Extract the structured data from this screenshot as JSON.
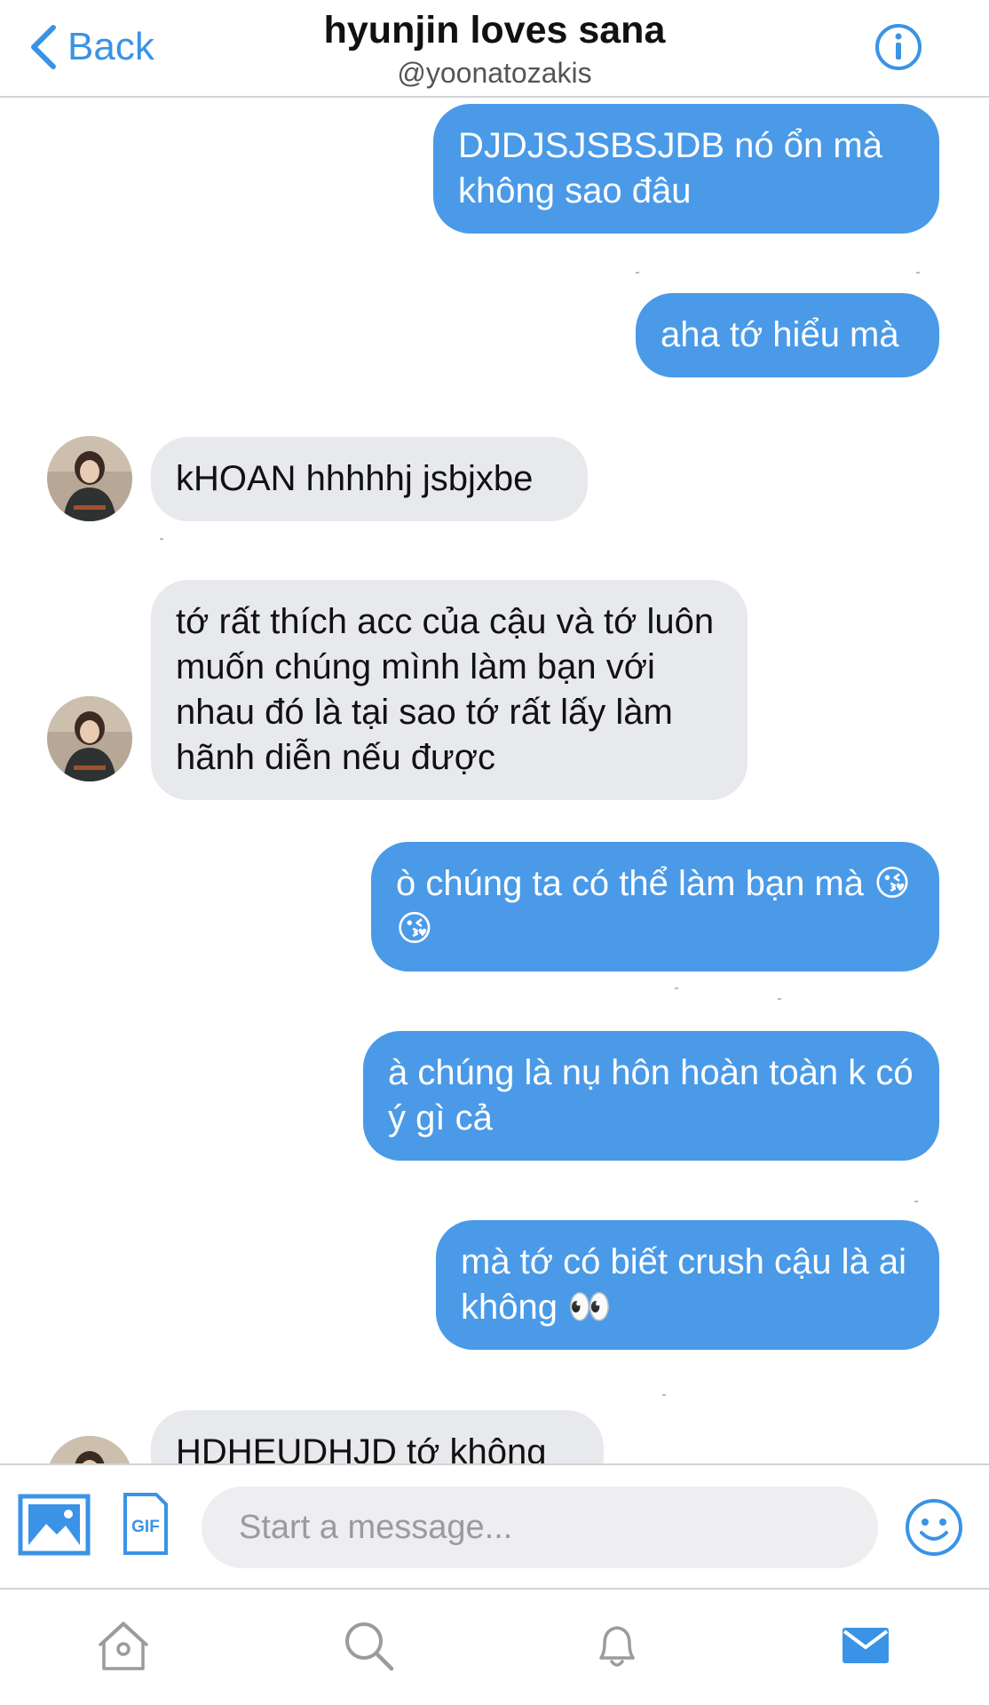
{
  "header": {
    "back_label": "Back",
    "title": "hyunjin loves sana",
    "handle": "@yoonatozakis"
  },
  "messages": [
    {
      "direction": "sent",
      "text": "DJDJSJSBSJDB nó ổn mà không sao đâu"
    },
    {
      "direction": "sent",
      "text": "aha tớ hiểu mà"
    },
    {
      "direction": "received",
      "text": "kHOAN hhhhhj jsbjxbe"
    },
    {
      "direction": "received",
      "text": "tớ rất thích acc của cậu và tớ luôn muốn chúng mình làm bạn với nhau đó là tại sao tớ rất lấy làm hãnh diễn nếu được"
    },
    {
      "direction": "sent",
      "text": "ò chúng ta có thể làm bạn mà 😘 😘"
    },
    {
      "direction": "sent",
      "text": "à chúng là nụ hôn hoàn toàn k có ý gì cả"
    },
    {
      "direction": "sent",
      "text": "mà tớ có biết crush cậu là ai không 👀"
    },
    {
      "direction": "received",
      "text": "HDHEUDHJD tớ không"
    }
  ],
  "composer": {
    "placeholder": "Start a message...",
    "gif_label": "GIF"
  },
  "tabs": [
    {
      "name": "home",
      "icon": "home-icon",
      "active": false
    },
    {
      "name": "search",
      "icon": "search-icon",
      "active": false
    },
    {
      "name": "notifications",
      "icon": "bell-icon",
      "active": false
    },
    {
      "name": "messages",
      "icon": "mail-icon",
      "active": true
    }
  ],
  "colors": {
    "accent": "#4a9ae8",
    "received_bubble": "#e8e9ed",
    "icon_gray": "#9a9a9f"
  }
}
